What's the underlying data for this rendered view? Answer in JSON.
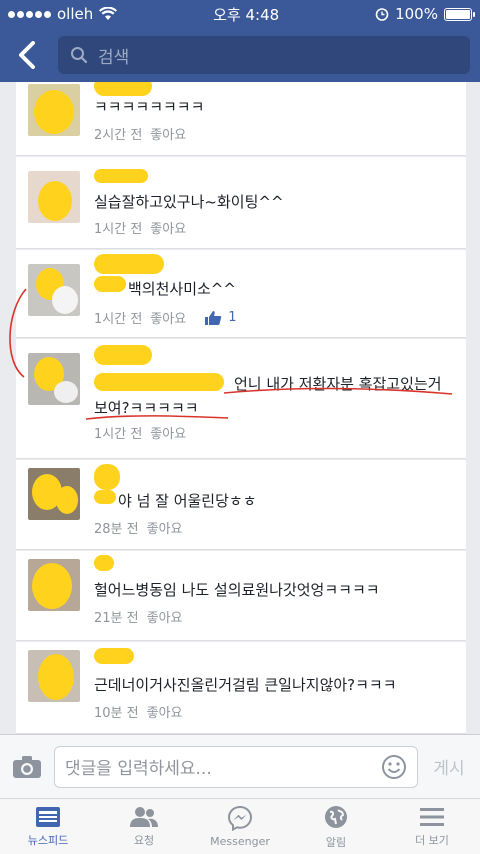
{
  "status": {
    "carrier": "olleh",
    "time": "오후 4:48",
    "battery": "100%"
  },
  "search": {
    "placeholder": "검색"
  },
  "comments": [
    {
      "text": "ㅋㅋㅋㅋㅋㅋㅋㅋ",
      "time": "2시간 전",
      "like": "좋아요"
    },
    {
      "text": "실습잘하고있구나~화이팅^^",
      "time": "1시간 전",
      "like": "좋아요"
    },
    {
      "text": "백의천사미소^^",
      "time": "1시간 전",
      "like": "좋아요",
      "likes": "1"
    },
    {
      "text": "언니 내가 저환자분 혹잡고있는거",
      "text2": "보여?ㅋㅋㅋㅋㅋ",
      "time": "1시간 전",
      "like": "좋아요"
    },
    {
      "text": "야 넘 잘 어울린당ㅎㅎ",
      "time": "28분 전",
      "like": "좋아요"
    },
    {
      "text": "헐어느병동임 나도 설의료원나갓엇엉ㅋㅋㅋㅋ",
      "time": "21분 전",
      "like": "좋아요"
    },
    {
      "text": "근데너이거사진올린거걸림 큰일나지않아?ㅋㅋㅋ",
      "time": "10분 전",
      "like": "좋아요"
    }
  ],
  "composer": {
    "placeholder": "댓글을 입력하세요...",
    "post_label": "게시"
  },
  "tabs": [
    "뉴스피드",
    "요청",
    "Messenger",
    "알림",
    "더 보기"
  ],
  "colors": {
    "brand": "#3b5998",
    "redact": "#ffd21e",
    "annotation": "#d9342b"
  }
}
